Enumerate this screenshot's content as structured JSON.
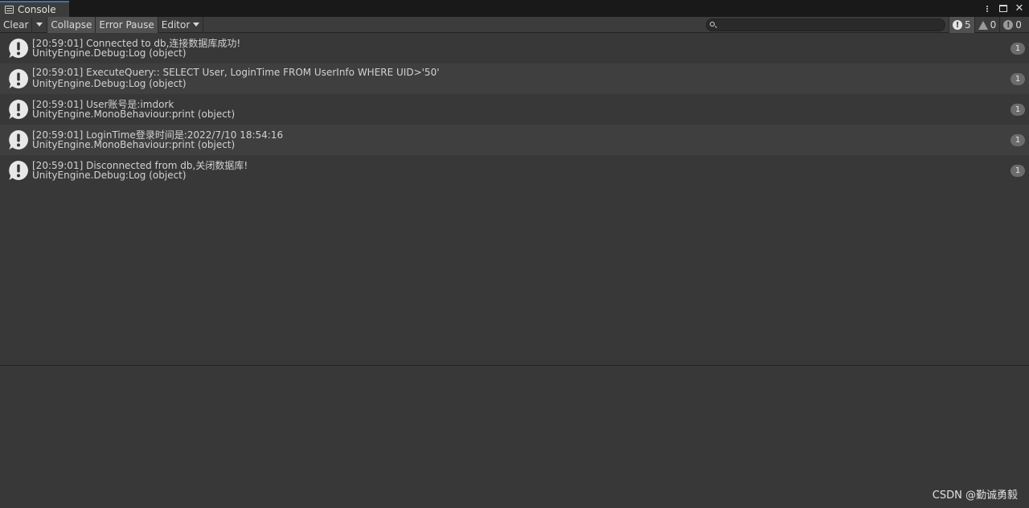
{
  "window": {
    "tab_title": "Console"
  },
  "toolbar": {
    "clear_label": "Clear",
    "collapse_label": "Collapse",
    "error_pause_label": "Error Pause",
    "editor_label": "Editor",
    "search_value": "",
    "info_count": "5",
    "warning_count": "0",
    "error_count": "0"
  },
  "logs": [
    {
      "line1": "[20:59:01] Connected to db,连接数据库成功!",
      "line2": "UnityEngine.Debug:Log (object)",
      "count": "1"
    },
    {
      "line1": "[20:59:01] ExecuteQuery:: SELECT User, LoginTime FROM UserInfo WHERE UID>'50'",
      "line2": "UnityEngine.Debug:Log (object)",
      "count": "1"
    },
    {
      "line1": "[20:59:01] User账号是:imdork",
      "line2": "UnityEngine.MonoBehaviour:print (object)",
      "count": "1"
    },
    {
      "line1": "[20:59:01] LoginTime登录时间是:2022/7/10 18:54:16",
      "line2": "UnityEngine.MonoBehaviour:print (object)",
      "count": "1"
    },
    {
      "line1": "[20:59:01] Disconnected from db,关闭数据库!",
      "line2": "UnityEngine.Debug:Log (object)",
      "count": "1"
    }
  ],
  "watermark": "CSDN @勤诚勇毅",
  "colors": {
    "background": "#383838",
    "toolbar": "#3c3c3c",
    "alt_row": "#3f3f3f",
    "tab_accent": "#3a72b0"
  }
}
